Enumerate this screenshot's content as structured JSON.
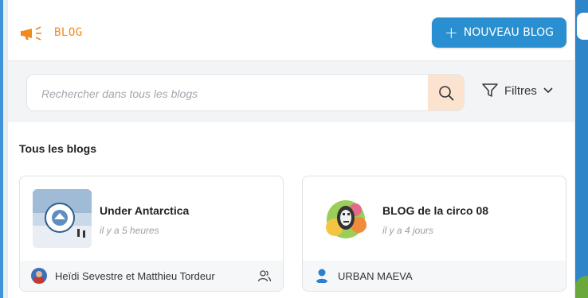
{
  "header": {
    "title": "BLOG",
    "new_button_label": "NOUVEAU BLOG"
  },
  "search": {
    "placeholder": "Rechercher dans tous les blogs",
    "value": "",
    "filters_label": "Filtres"
  },
  "section_title": "Tous les blogs",
  "blogs": [
    {
      "name": "Under Antarctica",
      "time": "il y a 5 heures",
      "author": "Heïdi Sevestre et Matthieu Tordeur"
    },
    {
      "name": "BLOG de la circo 08",
      "time": "il y a 4 jours",
      "author": "URBAN MAEVA"
    }
  ],
  "colors": {
    "accent_orange": "#f08a1c",
    "primary_blue": "#2a8fd0",
    "search_button_bg": "#fbe3d0"
  }
}
